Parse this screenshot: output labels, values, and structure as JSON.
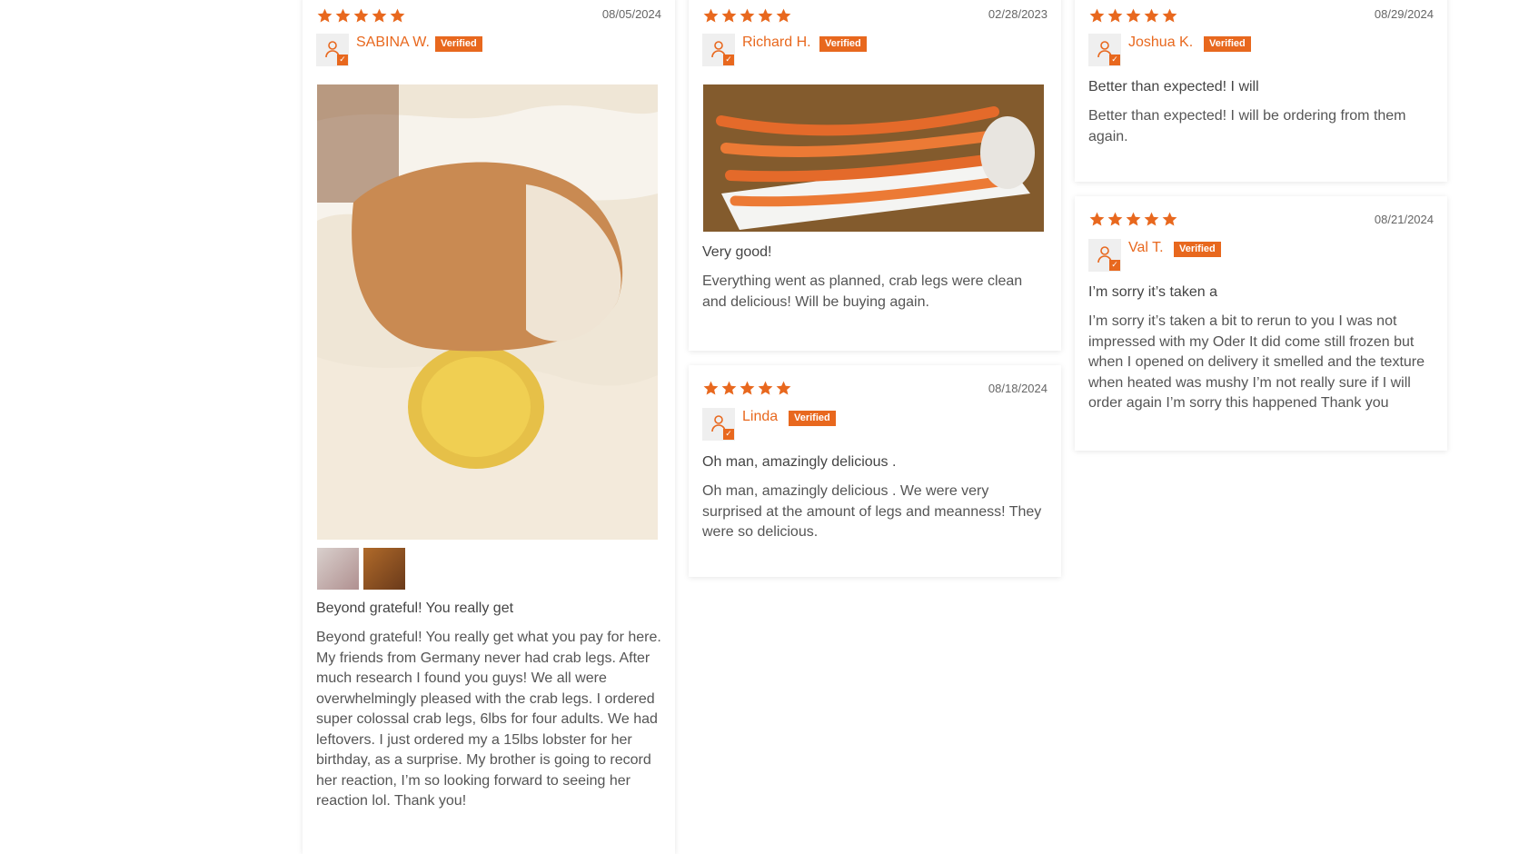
{
  "reviews": [
    {
      "date": "08/05/2024",
      "name": "SABINA W.",
      "badge": "Verified",
      "title": "Beyond grateful! You really get",
      "body": "Beyond grateful! You really get what you pay for here. My friends from Germany never had crab legs. After much research I found you guys! We all were overwhelmingly pleased with the crab legs. I ordered super colossal crab legs, 6lbs for four adults. We had leftovers. I just ordered my a 15lbs lobster for her birthday, as a surprise. My brother is going to record her reaction, I’m so looking forward to seeing her reaction lol. Thank you!",
      "stars": 5
    },
    {
      "date": "02/28/2023",
      "name": "Richard H.",
      "badge": "Verified",
      "title": "Very good!",
      "body": "Everything went as planned, crab legs were clean and delicious! Will be buying again.",
      "stars": 5
    },
    {
      "date": "08/18/2024",
      "name": "Linda",
      "badge": "Verified",
      "title": "Oh man, amazingly delicious .",
      "body": "Oh man, amazingly delicious . We were very surprised at the amount of legs and meanness! They were so delicious.",
      "stars": 5
    },
    {
      "date": "08/29/2024",
      "name": "Joshua K.",
      "badge": "Verified",
      "title": "Better than expected! I will",
      "body": "Better than expected! I will be ordering from them again.",
      "stars": 5
    },
    {
      "date": "08/21/2024",
      "name": "Val T.",
      "badge": "Verified",
      "title": "I’m sorry it’s taken a",
      "body": "I’m sorry it’s taken a bit to rerun to you I was not impressed with my Oder It did come still frozen but when I opened on delivery it smelled and the texture when heated was mushy I’m not really sure if I will order again I’m sorry this happened Thank you",
      "stars": 5
    }
  ],
  "icons": {
    "star": "star-icon",
    "avatar": "user-icon",
    "check": "check-icon"
  },
  "colors": {
    "accent": "#e8681e"
  }
}
